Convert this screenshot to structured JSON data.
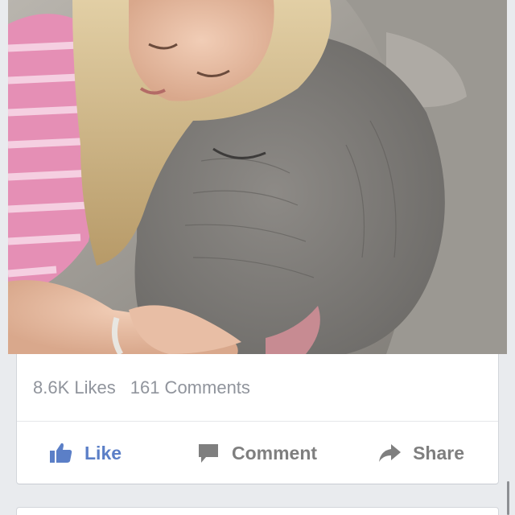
{
  "post": {
    "photo_alt_icon": "photo-girl-hugging-baby-elephant",
    "likes_count": "8.6K Likes",
    "comments_count": "161 Comments"
  },
  "actions": {
    "like_label": "Like",
    "comment_label": "Comment",
    "share_label": "Share",
    "like_icon": "thumbs-up-icon",
    "comment_icon": "speech-bubble-icon",
    "share_icon": "share-arrow-icon"
  },
  "colors": {
    "like_blue": "#5b7fc7",
    "muted_text": "#90949c",
    "action_gray": "#7f7f7f",
    "feed_background": "#e9ebee"
  }
}
